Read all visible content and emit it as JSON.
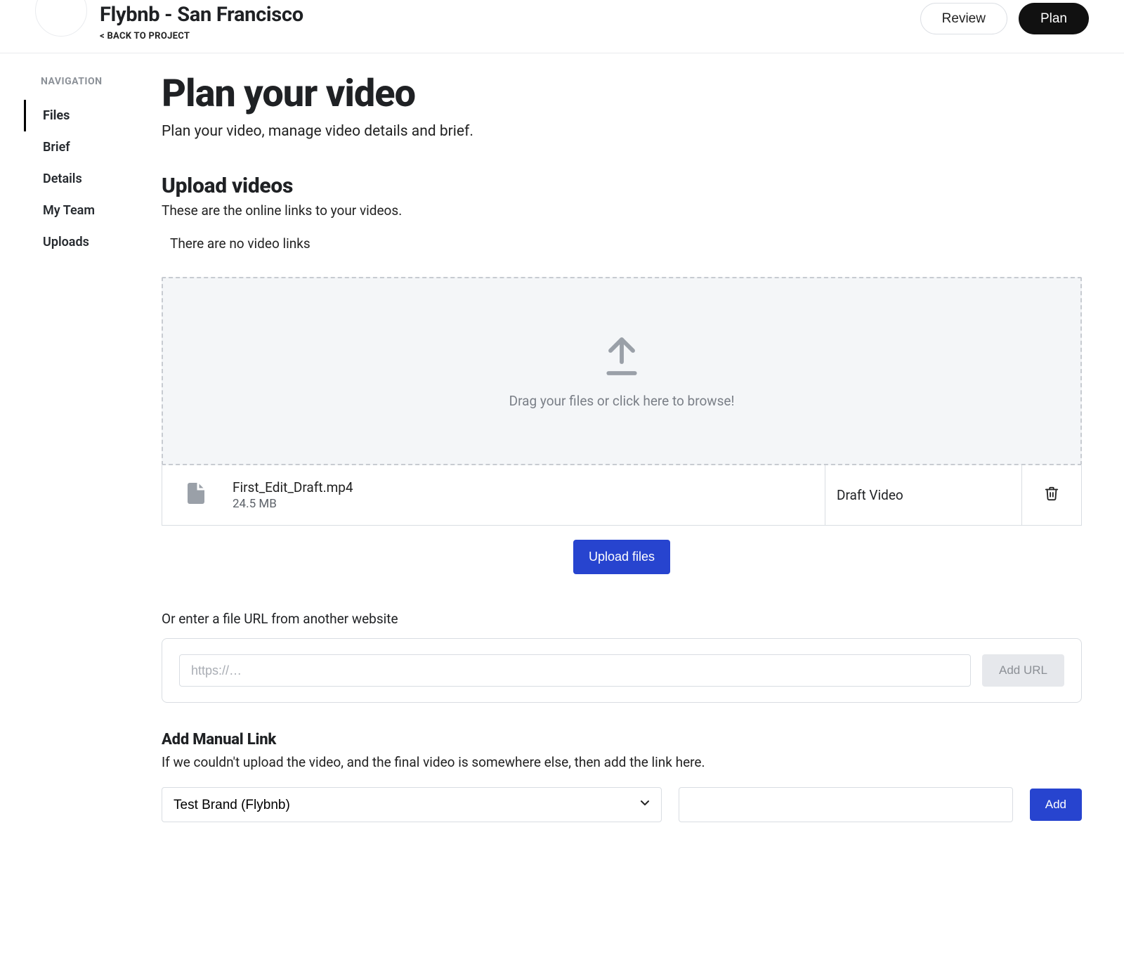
{
  "header": {
    "project_title": "Flybnb - San Francisco",
    "back_label": "< BACK TO PROJECT",
    "review_label": "Review",
    "plan_label": "Plan"
  },
  "sidebar": {
    "heading": "NAVIGATION",
    "items": [
      {
        "label": "Files",
        "active": true
      },
      {
        "label": "Brief",
        "active": false
      },
      {
        "label": "Details",
        "active": false
      },
      {
        "label": "My Team",
        "active": false
      },
      {
        "label": "Uploads",
        "active": false
      }
    ]
  },
  "main": {
    "title": "Plan your video",
    "subtitle": "Plan your video, manage video details and brief.",
    "upload_section": {
      "heading": "Upload videos",
      "desc": "These are the online links to your videos.",
      "empty": "There are no video links",
      "dropzone_text": "Drag your files or click here to browse!",
      "file": {
        "name": "First_Edit_Draft.mp4",
        "size": "24.5 MB",
        "label": "Draft Video"
      },
      "upload_button": "Upload files"
    },
    "url_section": {
      "label": "Or enter a file URL from another website",
      "placeholder": "https://…",
      "button": "Add URL"
    },
    "manual_section": {
      "heading": "Add Manual Link",
      "desc": "If we couldn't upload the video, and the final video is somewhere else, then add the link here.",
      "select_value": "Test Brand (Flybnb)",
      "add_button": "Add"
    }
  }
}
